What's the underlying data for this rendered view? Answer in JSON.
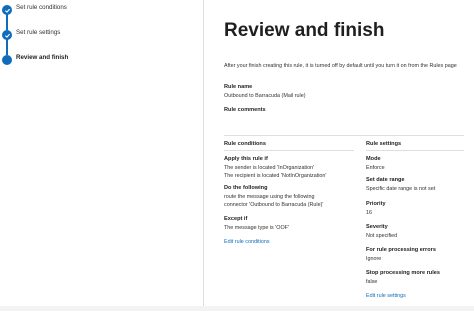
{
  "steps": [
    {
      "label": "Set rule conditions",
      "state": "done"
    },
    {
      "label": "Set rule settings",
      "state": "done"
    },
    {
      "label": "Review and finish",
      "state": "current"
    }
  ],
  "page": {
    "title": "Review and finish",
    "intro": "After your finish creating this rule, it is turned off by default until you turn it on from the Rules page"
  },
  "rule": {
    "name_label": "Rule name",
    "name_value": "Outbound to Barracuda (Mail rule)",
    "comments_label": "Rule comments"
  },
  "conditions": {
    "header": "Rule conditions",
    "apply_label": "Apply this rule if",
    "apply_lines": [
      "The sender is located 'InOrganization'",
      "The recipient is located 'NotInOrganization'"
    ],
    "do_label": "Do the following",
    "do_lines": [
      "route the message using the following",
      "connector 'Outbound to Barracuda (Rule)'"
    ],
    "except_label": "Except if",
    "except_lines": [
      "The message type is 'OOF'"
    ],
    "edit_link": "Edit rule conditions"
  },
  "settings": {
    "header": "Rule settings",
    "mode_label": "Mode",
    "mode_value": "Enforce",
    "date_label": "Set date range",
    "date_value": "Specific date range is not set",
    "priority_label": "Priority",
    "priority_value": "16",
    "severity_label": "Severity",
    "severity_value": "Not specified",
    "errors_label": "For rule processing errors",
    "errors_value": "Ignore",
    "stop_label": "Stop processing more rules",
    "stop_value": "false",
    "edit_link": "Edit rule settings"
  },
  "colors": {
    "accent": "#0f6cbd",
    "text": "#201f1e",
    "divider": "#e1dfdd"
  }
}
